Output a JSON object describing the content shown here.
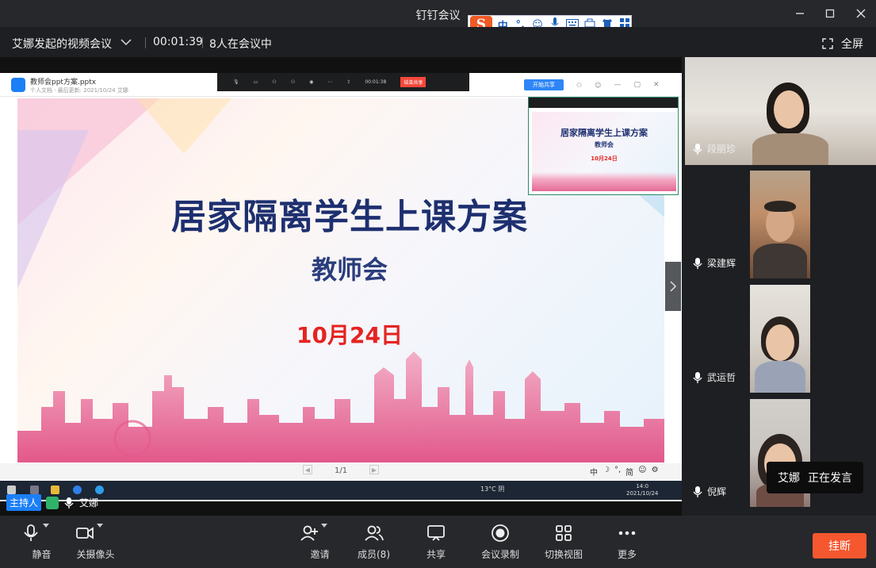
{
  "window": {
    "title": "钉钉会议"
  },
  "ime_toolbar": {
    "logo": "S",
    "mode": "中",
    "punct": "°,"
  },
  "meeting": {
    "name": "艾娜发起的视频会议",
    "duration": "00:01:39",
    "participants_text": "8人在会议中",
    "fullscreen_label": "全屏"
  },
  "shared_screen": {
    "file_name": "教师会ppt方案.pptx",
    "file_sub": "个人文档  ·  最后更新: 2021/10/24  艾娜",
    "share_btn": "开始共享",
    "end_btn": "结束共享",
    "toolbar_time": "00:01:38",
    "slide": {
      "title": "居家隔离学生上课方案",
      "subtitle": "教师会",
      "date": "10月24日"
    },
    "page_indicator": "1/1",
    "ime_status": [
      "中",
      "☽",
      "°,",
      "简",
      "☺",
      "⚙"
    ],
    "taskbar_weather": "13°C 阴",
    "taskbar_time": "14:0",
    "taskbar_date": "2021/10/24"
  },
  "presenter_bar": {
    "host_badge": "主持人",
    "presenter_name": "艾娜"
  },
  "participants": [
    {
      "name": "段丽珍"
    },
    {
      "name": "梁建辉"
    },
    {
      "name": "武运哲"
    },
    {
      "name": "倪辉"
    }
  ],
  "speaking_toast": {
    "name": "艾娜",
    "status": "正在发言"
  },
  "controls": {
    "mute": "静音",
    "camera": "关摄像头",
    "invite": "邀请",
    "members": "成员(8)",
    "share": "共享",
    "record": "会议录制",
    "switch_view": "切换视图",
    "more": "更多",
    "hangup": "挂断"
  },
  "colors": {
    "accent": "#1b7ff7",
    "hangup": "#f5572f",
    "slide_title": "#1d2f6f",
    "slide_date": "#e52321"
  }
}
